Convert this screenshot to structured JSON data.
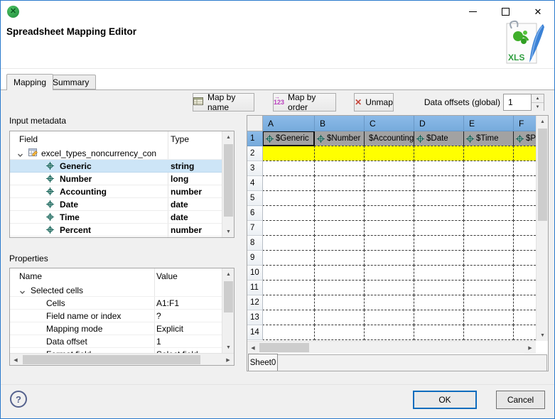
{
  "header": {
    "title": "Spreadsheet Mapping Editor",
    "file_badge": "XLS"
  },
  "tabs": [
    {
      "label": "Mapping",
      "active": true
    },
    {
      "label": "Summary",
      "active": false
    }
  ],
  "toolbar": {
    "map_by_name_label": "Map by name",
    "map_by_order_label": "Map by order",
    "unmap_label": "Unmap",
    "order_icon_text": "123",
    "data_offsets_label": "Data offsets (global)",
    "data_offsets_value": "1"
  },
  "input_metadata": {
    "label": "Input metadata",
    "columns": [
      "Field",
      "Type"
    ],
    "root": "excel_types_noncurrency_con",
    "fields": [
      {
        "name": "Generic",
        "type": "string",
        "selected": true
      },
      {
        "name": "Number",
        "type": "long"
      },
      {
        "name": "Accounting",
        "type": "number"
      },
      {
        "name": "Date",
        "type": "date"
      },
      {
        "name": "Time",
        "type": "date"
      },
      {
        "name": "Percent",
        "type": "number"
      }
    ]
  },
  "properties": {
    "label": "Properties",
    "columns": [
      "Name",
      "Value"
    ],
    "group": "Selected cells",
    "rows": [
      {
        "name": "Cells",
        "value": "A1:F1"
      },
      {
        "name": "Field name or index",
        "value": "?"
      },
      {
        "name": "Mapping mode",
        "value": "Explicit"
      },
      {
        "name": "Data offset",
        "value": "1"
      },
      {
        "name": "Format field",
        "value": "Select field",
        "clipped": true
      }
    ]
  },
  "grid": {
    "columns": [
      "A",
      "B",
      "C",
      "D",
      "E",
      "F"
    ],
    "rows": [
      "1",
      "2",
      "3",
      "4",
      "5",
      "6",
      "7",
      "8",
      "9",
      "10",
      "11",
      "12",
      "13",
      "14"
    ],
    "mapped_cells": [
      "$Generic",
      "$Number",
      "$Accounting",
      "$Date",
      "$Time",
      "$Percent"
    ],
    "selected_cell": "A1",
    "highlight_row": 2,
    "sheet_tab": "Sheet0"
  },
  "footer": {
    "help": "?",
    "ok": "OK",
    "cancel": "Cancel"
  },
  "icons": {
    "close": "✕",
    "unmap": "✕",
    "arrow_up": "▲",
    "arrow_down": "▼",
    "arrow_left": "◀",
    "arrow_right": "▶",
    "spin_up": "▲",
    "spin_down": "▼"
  },
  "colors": {
    "window_border": "#2979CC",
    "accent_blue": "#0F6CBD",
    "header_blue": "#7FB2E2",
    "mapped_cell_gray": "#A2A2A2",
    "selection_yellow": "#FFFF00",
    "selected_tree_row": "#CDE5F7"
  }
}
